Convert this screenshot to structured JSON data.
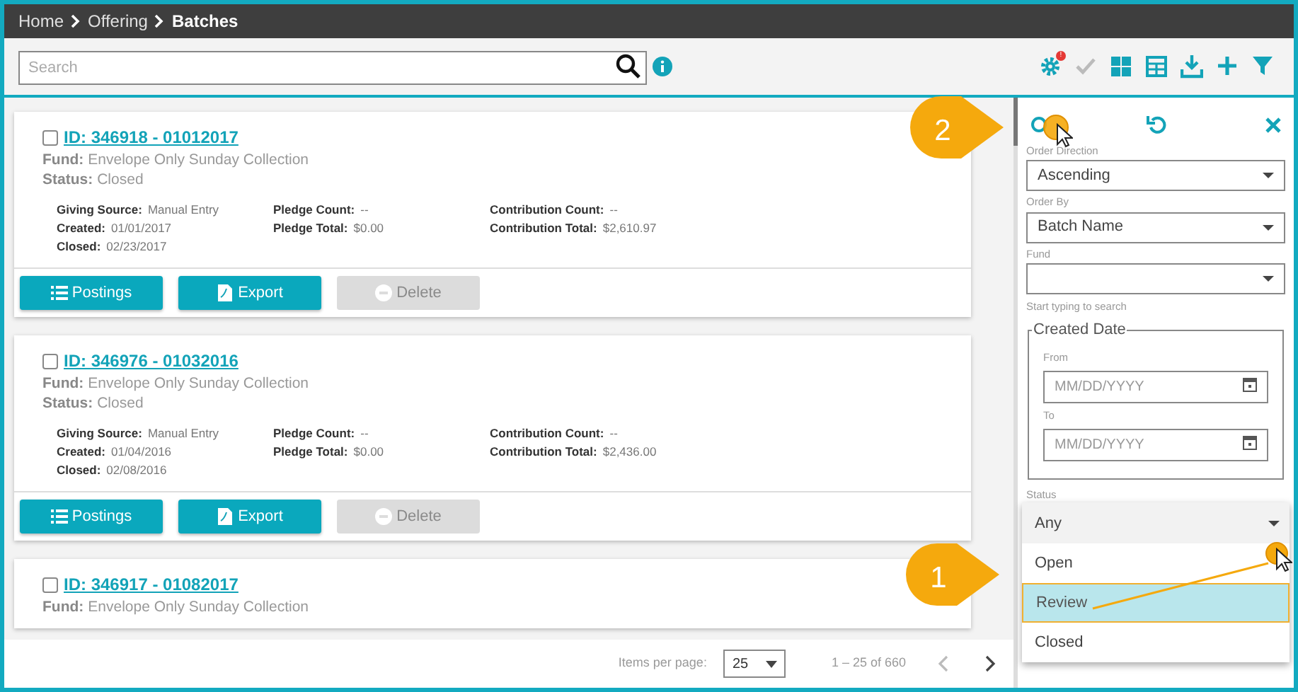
{
  "breadcrumb": [
    {
      "label": "Home",
      "current": false
    },
    {
      "label": "Offering",
      "current": false
    },
    {
      "label": "Batches",
      "current": true
    }
  ],
  "search": {
    "placeholder": "Search"
  },
  "toolbar": [
    {
      "kind": "gear",
      "badge": "!",
      "disabled": false
    },
    {
      "kind": "check",
      "disabled": true
    },
    {
      "kind": "tiles",
      "disabled": false
    },
    {
      "kind": "table",
      "disabled": false
    },
    {
      "kind": "download",
      "disabled": false
    },
    {
      "kind": "plus",
      "disabled": false
    },
    {
      "kind": "filter",
      "disabled": false
    }
  ],
  "batches": [
    {
      "id": "ID: 346918 - 01012017",
      "checked": false,
      "fund_label": "Fund:",
      "fund": "Envelope Only Sunday Collection",
      "status_label": "Status:",
      "status": "Closed",
      "details": [
        [
          {
            "label": "Giving Source:",
            "value": "Manual Entry"
          },
          {
            "label": "Created:",
            "value": "01/01/2017"
          },
          {
            "label": "Closed:",
            "value": "02/23/2017"
          }
        ],
        [
          {
            "label": "Pledge Count:",
            "value": "--"
          },
          {
            "label": "Pledge Total:",
            "value": "$0.00"
          }
        ],
        [
          {
            "label": "Contribution Count:",
            "value": "--"
          },
          {
            "label": "Contribution Total:",
            "value": "$2,610.97"
          }
        ]
      ],
      "actions": [
        {
          "kind": "list",
          "label": "Postings",
          "disabled": false
        },
        {
          "kind": "pdf",
          "label": "Export",
          "disabled": false
        },
        {
          "kind": "minus",
          "label": "Delete",
          "disabled": true
        }
      ]
    },
    {
      "id": "ID: 346976 - 01032016",
      "checked": false,
      "fund_label": "Fund:",
      "fund": "Envelope Only Sunday Collection",
      "status_label": "Status:",
      "status": "Closed",
      "details": [
        [
          {
            "label": "Giving Source:",
            "value": "Manual Entry"
          },
          {
            "label": "Created:",
            "value": "01/04/2016"
          },
          {
            "label": "Closed:",
            "value": "02/08/2016"
          }
        ],
        [
          {
            "label": "Pledge Count:",
            "value": "--"
          },
          {
            "label": "Pledge Total:",
            "value": "$0.00"
          }
        ],
        [
          {
            "label": "Contribution Count:",
            "value": "--"
          },
          {
            "label": "Contribution Total:",
            "value": "$2,436.00"
          }
        ]
      ],
      "actions": [
        {
          "kind": "list",
          "label": "Postings",
          "disabled": false
        },
        {
          "kind": "pdf",
          "label": "Export",
          "disabled": false
        },
        {
          "kind": "minus",
          "label": "Delete",
          "disabled": true
        }
      ]
    },
    {
      "id": "ID: 346917 - 01082017",
      "checked": false,
      "fund_label": "Fund:",
      "fund": "Envelope Only Sunday Collection"
    }
  ],
  "pagination": {
    "label": "Items per page:",
    "per_page": "25",
    "range": "1 – 25 of 660"
  },
  "filter_panel": {
    "order_direction": {
      "label": "Order Direction",
      "value": "Ascending"
    },
    "order_by": {
      "label": "Order By",
      "value": "Batch Name"
    },
    "fund": {
      "label": "Fund",
      "hint": "Start typing to search"
    },
    "created_date": {
      "legend": "Created Date",
      "from": {
        "label": "From",
        "placeholder": "MM/DD/YYYY"
      },
      "to": {
        "label": "To",
        "placeholder": "MM/DD/YYYY"
      }
    },
    "status": {
      "label": "Status",
      "value": "Any",
      "options": [
        {
          "label": "Open",
          "selected": false
        },
        {
          "label": "Review",
          "selected": true
        },
        {
          "label": "Closed",
          "selected": false
        }
      ]
    }
  },
  "callouts": [
    "2",
    "1"
  ]
}
